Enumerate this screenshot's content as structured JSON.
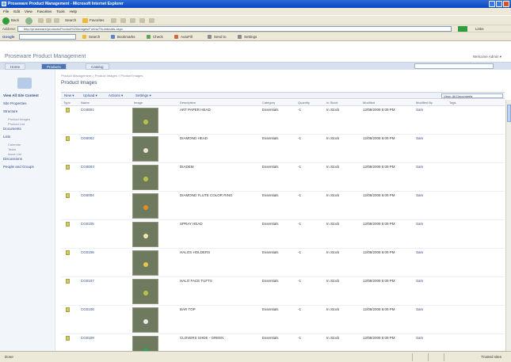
{
  "window": {
    "title": "Proseware Product Management - Microsoft Internet Explorer"
  },
  "menu": [
    "File",
    "Edit",
    "View",
    "Favorites",
    "Tools",
    "Help"
  ],
  "nav": {
    "back": "Back",
    "search": "Search",
    "favorites": "Favorites"
  },
  "address": {
    "label": "Address",
    "url": "http://proseware/products/Product%20Images/Forms/Thumbnails.aspx",
    "go": "Go",
    "links": "Links"
  },
  "google": {
    "label": "Google",
    "items": [
      "Search",
      "Bookmarks",
      "Check",
      "AutoFill",
      "Send to",
      "Settings"
    ]
  },
  "site": {
    "title": "Proseware Product Management",
    "welcome": "Welcome Admin ▾"
  },
  "tabs": [
    {
      "label": "Home",
      "selected": false
    },
    {
      "label": "Products",
      "selected": true
    },
    {
      "label": "Catalog",
      "selected": false
    }
  ],
  "leftnav": {
    "view_all": "View All Site Content",
    "items": [
      {
        "label": "Site Properties",
        "sub": false
      },
      {
        "label": "Structure",
        "sub": false
      },
      {
        "label": "Product Images",
        "sub": true
      },
      {
        "label": "Product List",
        "sub": true
      },
      {
        "label": "Documents",
        "sub": false
      },
      {
        "label": "Lists",
        "sub": false
      },
      {
        "label": "Calendar",
        "sub": true
      },
      {
        "label": "Tasks",
        "sub": true
      },
      {
        "label": "Issue List",
        "sub": true
      },
      {
        "label": "Discussions",
        "sub": false
      },
      {
        "label": "People and Groups",
        "sub": false
      }
    ]
  },
  "breadcrumb": "Product Management > Product Images > Product Images",
  "page_title": "Product Images",
  "toolbar": {
    "new": "New ▾",
    "upload": "Upload ▾",
    "actions": "Actions ▾",
    "settings": "Settings ▾",
    "view": "View: All Documents"
  },
  "columns": [
    "Type",
    "Name",
    "Image",
    "Description",
    "Category",
    "Quantity",
    "In Stock",
    "Modified",
    "Modified By",
    "Tags"
  ],
  "rows": [
    {
      "name": "CG0001",
      "title": "ART PAPER HEAD",
      "category": "Essentials",
      "qty": "-1",
      "stock": "In Stock",
      "modified": "12/08/2008 5:09 PM",
      "by": "Sam",
      "dot": "#b7c44c"
    },
    {
      "name": "CG0002",
      "title": "DIAMOND HEAD",
      "category": "Essentials",
      "qty": "-1",
      "stock": "In Stock",
      "modified": "12/08/2008 5:09 PM",
      "by": "Sam",
      "dot": "#e9e6d8"
    },
    {
      "name": "CG0003",
      "title": "DIADEM",
      "category": "Essentials",
      "qty": "-1",
      "stock": "In Stock",
      "modified": "12/08/2008 5:09 PM",
      "by": "Sam",
      "dot": "#b7c44c"
    },
    {
      "name": "CG0004",
      "title": "DIAMOND FLUTE COLOR RING",
      "category": "Essentials",
      "qty": "-1",
      "stock": "In Stock",
      "modified": "12/08/2008 5:09 PM",
      "by": "Sam",
      "dot": "#e98a1c"
    },
    {
      "name": "CG0105",
      "title": "SPRAY HEAD",
      "category": "Essentials",
      "qty": "-1",
      "stock": "In Stock",
      "modified": "12/08/2008 5:09 PM",
      "by": "Sam",
      "dot": "#f1e6b2"
    },
    {
      "name": "CG0106",
      "title": "HALOS HOLDERS",
      "category": "Essentials",
      "qty": "-1",
      "stock": "In Stock",
      "modified": "12/08/2008 5:09 PM",
      "by": "Sam",
      "dot": "#e8c84a"
    },
    {
      "name": "CG0107",
      "title": "HALO FACE TUFTS",
      "category": "Essentials",
      "qty": "-1",
      "stock": "In Stock",
      "modified": "12/08/2008 5:09 PM",
      "by": "Sam",
      "dot": "#b7c44c"
    },
    {
      "name": "CG0108",
      "title": "BAR TOP",
      "category": "Essentials",
      "qty": "-1",
      "stock": "In Stock",
      "modified": "12/08/2008 5:09 PM",
      "by": "Sam",
      "dot": "#e9ece8"
    },
    {
      "name": "CG0109",
      "title": "CLOVERS SHOE - GREEN",
      "category": "Essentials",
      "qty": "-1",
      "stock": "In Stock",
      "modified": "12/08/2008 5:09 PM",
      "by": "Sam",
      "dot": "#2fa35a"
    }
  ],
  "status": {
    "left": "Done",
    "right": "Trusted sites"
  }
}
